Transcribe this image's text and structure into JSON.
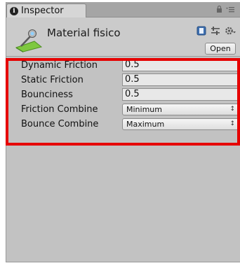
{
  "tab": {
    "title": "Inspector",
    "info_icon": "info-icon",
    "lock_icon": "lock-icon",
    "menu_icon": "menu-icon"
  },
  "header": {
    "title": "Material fisico",
    "asset_icon": "physic-material-icon",
    "help_icon": "help-book-icon",
    "layout_icon": "settings-sliders-icon",
    "gear_icon": "gear-icon",
    "open_label": "Open"
  },
  "properties": [
    {
      "label": "Dynamic Friction",
      "value": "0.5",
      "kind": "field"
    },
    {
      "label": "Static Friction",
      "value": "0.5",
      "kind": "field"
    },
    {
      "label": "Bounciness",
      "value": "0.5",
      "kind": "field"
    },
    {
      "label": "Friction Combine",
      "value": "Minimum",
      "kind": "dropdown"
    },
    {
      "label": "Bounce Combine",
      "value": "Maximum",
      "kind": "dropdown"
    }
  ],
  "colors": {
    "highlight": "#e60000",
    "panel": "#c2c2c2"
  }
}
